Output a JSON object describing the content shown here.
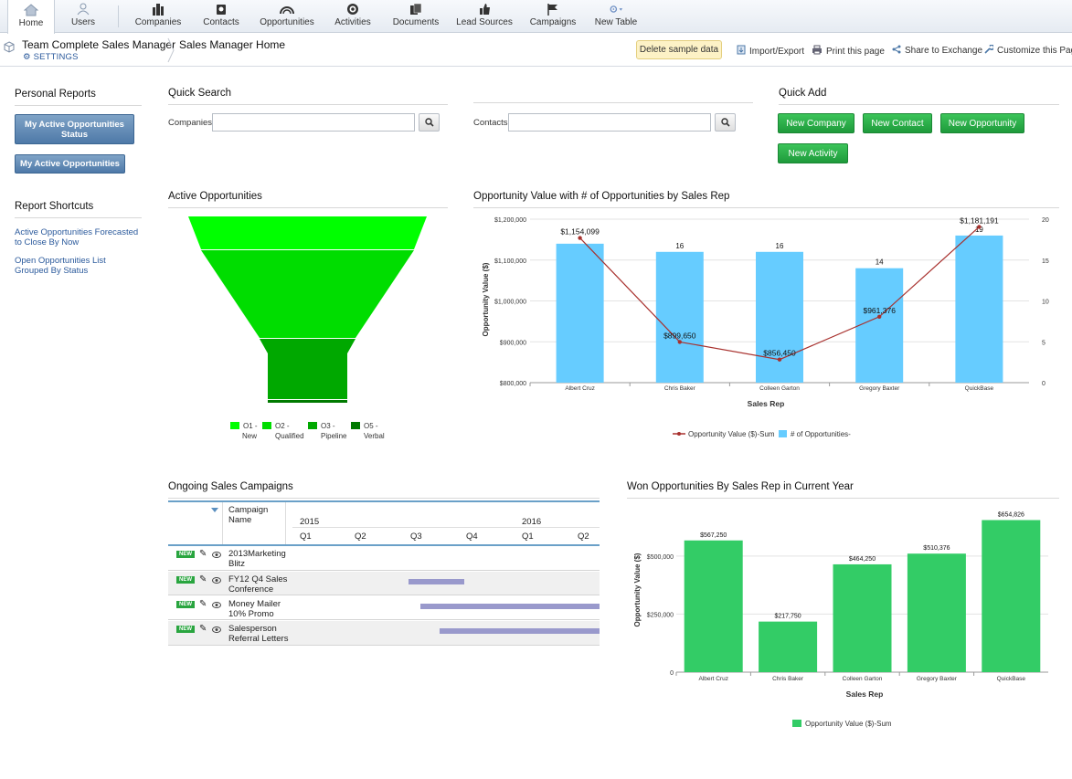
{
  "nav": {
    "items": [
      {
        "label": "Home",
        "icon": "house-icon"
      },
      {
        "label": "Users",
        "icon": "user-icon"
      },
      {
        "label": "Companies",
        "icon": "buildings-icon"
      },
      {
        "label": "Contacts",
        "icon": "rolodex-icon"
      },
      {
        "label": "Opportunities",
        "icon": "gauge-icon"
      },
      {
        "label": "Activities",
        "icon": "target-icon"
      },
      {
        "label": "Documents",
        "icon": "documents-icon"
      },
      {
        "label": "Lead Sources",
        "icon": "thumbs-up-icon"
      },
      {
        "label": "Campaigns",
        "icon": "flag-icon"
      },
      {
        "label": "New Table",
        "icon": "gear-icon"
      }
    ]
  },
  "header": {
    "app_title": "Team Complete Sales Manager",
    "settings": "SETTINGS",
    "page_title": "Sales Manager Home",
    "delete_sample": "Delete sample data",
    "import_export": "Import/Export",
    "print": "Print this page",
    "share": "Share to Exchange",
    "customize": "Customize this Page"
  },
  "personal_reports": {
    "heading": "Personal Reports",
    "btn1": "My Active Opportunities Status",
    "btn2": "My Active Opportunities"
  },
  "report_shortcuts": {
    "heading": "Report Shortcuts",
    "link1": "Active Opportunities Forecasted to Close By Now",
    "link2": "Open Opportunities List Grouped By Status"
  },
  "quick_search": {
    "heading": "Quick Search",
    "companies_label": "Companies",
    "contacts_label": "Contacts"
  },
  "quick_add": {
    "heading": "Quick Add",
    "new_company": "New Company",
    "new_contact": "New Contact",
    "new_opportunity": "New Opportunity",
    "new_activity": "New Activity"
  },
  "funnel": {
    "heading": "Active Opportunities",
    "legend": [
      {
        "label1": "O1 -",
        "label2": "New",
        "color": "#00ff00"
      },
      {
        "label1": "O2 -",
        "label2": "Qualified",
        "color": "#00dd00"
      },
      {
        "label1": "O3 -",
        "label2": "Pipeline",
        "color": "#00a800"
      },
      {
        "label1": "O5 -",
        "label2": "Verbal",
        "color": "#007a00"
      }
    ]
  },
  "combo_chart": {
    "heading": "Opportunity Value with # of Opportunities by Sales Rep",
    "ylabel": "Opportunity Value ($)",
    "xlabel": "Sales Rep",
    "y_ticks": [
      "$800,000",
      "$900,000",
      "$1,000,000",
      "$1,100,000",
      "$1,200,000"
    ],
    "y2_ticks": [
      "0",
      "5",
      "10",
      "15",
      "20"
    ],
    "legend_line": "Opportunity Value ($)-Sum",
    "legend_bar": "# of Opportunities-",
    "bar_labels": [
      "",
      "16",
      "16",
      "14",
      "19"
    ],
    "value_labels": [
      "$1,154,099",
      "$899,650",
      "$856,450",
      "$961,376",
      "$1,181,191"
    ]
  },
  "campaigns": {
    "heading": "Ongoing Sales Campaigns",
    "col_name": "Campaign Name",
    "year1": "2015",
    "year2": "2016",
    "quarters": [
      "Q1",
      "Q2",
      "Q3",
      "Q4",
      "Q1",
      "Q2"
    ],
    "new_badge": "NEW",
    "rows": [
      {
        "name": "2013Marketing Blitz"
      },
      {
        "name": "FY12 Q4 Sales Conference"
      },
      {
        "name": "Money Mailer 10% Promo"
      },
      {
        "name": "Salesperson Referral Letters"
      }
    ]
  },
  "won_chart": {
    "heading": "Won Opportunities By Sales Rep in Current Year",
    "ylabel": "Opportunity Value ($)",
    "xlabel": "Sales Rep",
    "y_ticks": [
      "0",
      "$250,000",
      "$500,000"
    ],
    "legend": "Opportunity Value ($)-Sum",
    "value_labels": [
      "$567,250",
      "$217,750",
      "$464,250",
      "$510,376",
      "$654,826"
    ]
  },
  "chart_data": [
    {
      "type": "bar",
      "title": "Opportunity Value with # of Opportunities by Sales Rep",
      "xlabel": "Sales Rep",
      "ylabel": "Opportunity Value ($)",
      "categories": [
        "Albert Cruz",
        "Chris Baker",
        "Colleen Garton",
        "Gregory Baxter",
        "QuickBase"
      ],
      "ylim": [
        800000,
        1200000
      ],
      "y2lim": [
        0,
        20
      ],
      "series": [
        {
          "name": "Opportunity Value ($)-Sum",
          "type": "line",
          "axis": "left",
          "values": [
            1154099,
            899650,
            856450,
            961376,
            1181191
          ],
          "color": "#a8312e"
        },
        {
          "name": "# of Opportunities-",
          "type": "bar",
          "axis": "right",
          "values": [
            17,
            16,
            16,
            14,
            18
          ],
          "color": "#66ccff"
        }
      ],
      "legend": "bottom"
    },
    {
      "type": "bar",
      "title": "Won Opportunities By Sales Rep in Current Year",
      "xlabel": "Sales Rep",
      "ylabel": "Opportunity Value ($)",
      "categories": [
        "Albert Cruz",
        "Chris Baker",
        "Colleen Garton",
        "Gregory Baxter",
        "QuickBase"
      ],
      "ylim": [
        0,
        700000
      ],
      "series": [
        {
          "name": "Opportunity Value ($)-Sum",
          "values": [
            567250,
            217750,
            464250,
            510376,
            654826
          ],
          "color": "#33cc66"
        }
      ],
      "legend": "bottom"
    },
    {
      "type": "funnel",
      "title": "Active Opportunities",
      "categories": [
        "O1 - New",
        "O2 - Qualified",
        "O3 - Pipeline",
        "O5 - Verbal"
      ],
      "values": [
        0.2,
        0.5,
        0.35,
        0.02
      ],
      "colors": [
        "#00ff00",
        "#00dd00",
        "#00a800",
        "#007a00"
      ]
    },
    {
      "type": "gantt",
      "title": "Ongoing Sales Campaigns",
      "time_axis": [
        "2015 Q1",
        "2015 Q2",
        "2015 Q3",
        "2015 Q4",
        "2016 Q1",
        "2016 Q2"
      ],
      "bars": [
        {
          "name": "2013Marketing Blitz",
          "start": null,
          "end": null
        },
        {
          "name": "FY12 Q4 Sales Conference",
          "start": 2.2,
          "end": 3.2
        },
        {
          "name": "Money Mailer 10% Promo",
          "start": 2.4,
          "end": 6
        },
        {
          "name": "Salesperson Referral Letters",
          "start": 2.75,
          "end": 6
        }
      ],
      "bar_color": "#9999cc"
    }
  ]
}
